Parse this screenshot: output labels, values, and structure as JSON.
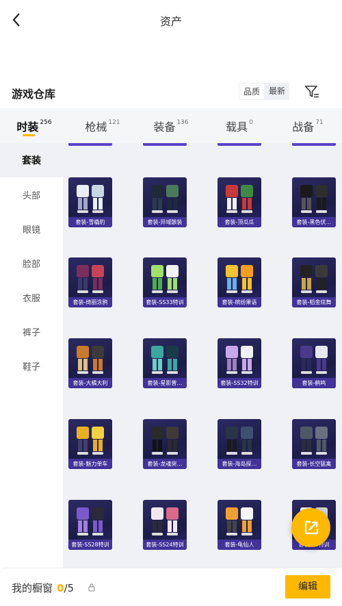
{
  "header": {
    "title": "资产"
  },
  "warehouse": {
    "title": "游戏仓库",
    "sort_options": [
      "品质",
      "最新"
    ],
    "active_sort": 0
  },
  "tabs": [
    {
      "label": "时装",
      "count": "256",
      "active": true
    },
    {
      "label": "枪械",
      "count": "121",
      "active": false
    },
    {
      "label": "装备",
      "count": "136",
      "active": false
    },
    {
      "label": "载具",
      "count": "0",
      "active": false
    },
    {
      "label": "战备",
      "count": "71",
      "active": false
    }
  ],
  "sidebar": {
    "items": [
      "套装",
      "头部",
      "眼镜",
      "脸部",
      "衣服",
      "裤子",
      "鞋子"
    ],
    "active": 0
  },
  "items": [
    {
      "label": "套装-雪橇豹",
      "art": "twins-white"
    },
    {
      "label": "套装-异域骸装",
      "art": "dark-pair"
    },
    {
      "label": "套装-顶瓜瓜",
      "art": "red-green"
    },
    {
      "label": "套装-黑色伏…",
      "art": "black-suit"
    },
    {
      "label": "套装-绮丽涂鸦",
      "art": "graffiti"
    },
    {
      "label": "套装-SS33特训",
      "art": "green-white"
    },
    {
      "label": "套装-缤纷果语",
      "art": "yellow-fruit"
    },
    {
      "label": "套装-稻金炫舞",
      "art": "dark-gold"
    },
    {
      "label": "套装-大橘大利",
      "art": "orange-pair"
    },
    {
      "label": "套装-星影曾…",
      "art": "teal-pair"
    },
    {
      "label": "套装-SS32特训",
      "art": "lilac"
    },
    {
      "label": "套装-鹤鸣",
      "art": "purple-pair"
    },
    {
      "label": "套装-魅力单车",
      "art": "yellow-shirt"
    },
    {
      "label": "套装-龙魂突…",
      "art": "dark-figure"
    },
    {
      "label": "套装-海岛探…",
      "art": "navy-jacket"
    },
    {
      "label": "套装-长空猛禽",
      "art": "grey-camo"
    },
    {
      "label": "套装-SS28特训",
      "art": "violet"
    },
    {
      "label": "套装-SS24特训",
      "art": "pink-white"
    },
    {
      "label": "套装-龟仙人",
      "art": "orange-tee"
    },
    {
      "label": "套装-SS特训",
      "art": "white-set"
    }
  ],
  "footer": {
    "my_window": "我的橱窗",
    "count": "0",
    "separator": "/",
    "total": "5",
    "edit_label": "编辑"
  },
  "colors": {
    "accent": "#ffb800",
    "card_bg": "#1c1c49",
    "card_label_bg": "#4634a0"
  },
  "icons": {
    "back": "chevron-left-icon",
    "filter": "filter-icon",
    "share": "share-icon",
    "lock": "lock-icon"
  }
}
